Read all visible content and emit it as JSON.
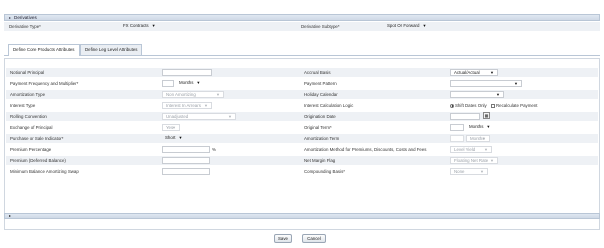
{
  "section": {
    "title": "Derivatives",
    "arrow": "▸"
  },
  "top": {
    "derivative_type_label": "Derivative Type*",
    "derivative_type_value": "FX Contracts",
    "derivative_subtype_label": "Derivative Subtype*",
    "derivative_subtype_value": "Spot Or Forward"
  },
  "tabs": [
    {
      "label": "Define Core Products Attributes"
    },
    {
      "label": "Define Leg Level Attributes"
    }
  ],
  "left_fields": [
    {
      "label": "Notional Principal",
      "value": ""
    },
    {
      "label": "Payment Frequency and Multiplier*",
      "value": "Months"
    },
    {
      "label": "Amortization Type",
      "value": "Non Amortizing"
    },
    {
      "label": "Interest Type",
      "value": "Interest In Arrears"
    },
    {
      "label": "Rolling Convention",
      "value": "Unadjusted"
    },
    {
      "label": "Exchange of Principal",
      "value": "Yes"
    },
    {
      "label": "Purchase or Sale Indicator*",
      "value": "Short"
    },
    {
      "label": "Premium Percentage",
      "value": "",
      "suffix": "%"
    },
    {
      "label": "Premium (Deferred Balance)",
      "value": ""
    },
    {
      "label": "Minimum Balance Amortizing Swap",
      "value": ""
    }
  ],
  "right_fields": [
    {
      "label": "Accrual Basis",
      "value": "Actual/Actual"
    },
    {
      "label": "Payment Pattern",
      "value": ""
    },
    {
      "label": "Holiday Calendar",
      "value": ""
    },
    {
      "label": "Interest Calculation Logic",
      "opt1": "Shift Dates Only",
      "opt2": "Recalculate Payment"
    },
    {
      "label": "Origination Date",
      "value": ""
    },
    {
      "label": "Original Term*",
      "value": "Months"
    },
    {
      "label": "Amortization Term",
      "value": "Months"
    },
    {
      "label": "Amortization Method for Premiums, Discounts, Costs and Fees",
      "value": "Level Yield"
    },
    {
      "label": "Net Margin Flag",
      "value": "Floating Net Rate"
    },
    {
      "label": "Compounding Basis*",
      "value": "None"
    }
  ],
  "footer": {
    "arrow": "▸"
  },
  "buttons": {
    "save": "Save",
    "cancel": "Cancel"
  }
}
